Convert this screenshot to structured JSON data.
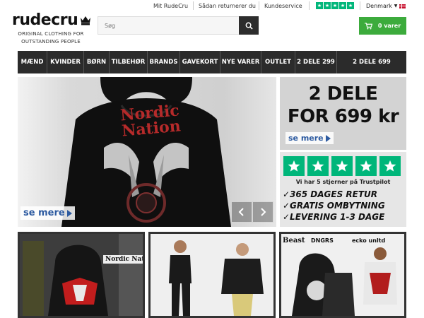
{
  "topbar": {
    "links": [
      "Mit RudeCru",
      "Sådan returnerer du",
      "Kundeservice"
    ],
    "country": "Denmark"
  },
  "logo": {
    "wordmark": "rudecru",
    "tagline_1": "ORIGINAL CLOTHING FOR",
    "tagline_2": "OUTSTANDING PEOPLE"
  },
  "search": {
    "placeholder": "Søg"
  },
  "cart": {
    "label": "0 varer"
  },
  "nav": {
    "items": [
      "MÆND",
      "KVINDER",
      "BØRN",
      "TILBEHØR",
      "BRANDS",
      "GAVEKORT",
      "NYE VARER",
      "OUTLET",
      "2 DELE 299",
      "2 DELE 699"
    ]
  },
  "hero": {
    "print_line_1": "Nordic",
    "print_line_2": "Nation",
    "see_more": "se mere"
  },
  "promo": {
    "line_1": "2 DELE",
    "line_2": "FOR 699 kr",
    "see_more": "se mere"
  },
  "trust": {
    "line": "Vi har 5 stjerner på Trustpilot",
    "benefits": [
      "✓365 DAGES RETUR",
      "✓GRATIS OMBYTNING",
      "✓LEVERING 1-3 DAGE"
    ]
  },
  "tiles": {
    "brand_1": "Nordic Nation",
    "brand_2": "Beast",
    "brand_3": "DNGRS",
    "brand_4": "ecko unltd"
  },
  "colors": {
    "nav_bg": "#2b2b2b",
    "cart_green": "#3cab3c",
    "trustpilot_green": "#00b67a",
    "link_blue": "#2c5aa0",
    "print_red": "#b52a2a"
  }
}
